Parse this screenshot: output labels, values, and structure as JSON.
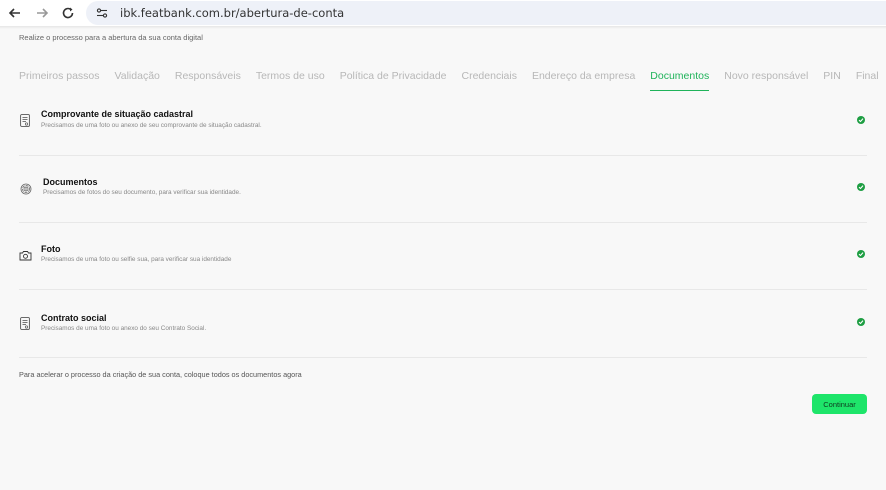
{
  "browser": {
    "url": "ibk.featbank.com.br/abertura-de-conta",
    "back_icon": "arrow-left-icon",
    "forward_icon": "arrow-right-icon",
    "reload_icon": "reload-icon"
  },
  "header": {
    "subtitle": "Realize o processo para a abertura da sua conta digital"
  },
  "tabs": [
    {
      "label": "Primeiros passos",
      "active": false
    },
    {
      "label": "Validação",
      "active": false
    },
    {
      "label": "Responsáveis",
      "active": false
    },
    {
      "label": "Termos de uso",
      "active": false
    },
    {
      "label": "Política de Privacidade",
      "active": false
    },
    {
      "label": "Credenciais",
      "active": false
    },
    {
      "label": "Endereço da empresa",
      "active": false
    },
    {
      "label": "Documentos",
      "active": true
    },
    {
      "label": "Novo responsável",
      "active": false
    },
    {
      "label": "PIN",
      "active": false
    },
    {
      "label": "Final",
      "active": false
    }
  ],
  "documents": [
    {
      "title": "Comprovante de situação cadastral",
      "description": "Precisamos de uma foto ou anexo de seu comprovante de situação cadastral.",
      "icon": "document-icon",
      "status": "check-icon"
    },
    {
      "title": "Documentos",
      "description": "Precisamos de fotos do seu documento, para verificar sua identidade.",
      "icon": "fingerprint-icon",
      "status": "check-icon"
    },
    {
      "title": "Foto",
      "description": "Precisamos de uma foto ou selfie sua, para verificar sua identidade",
      "icon": "camera-icon",
      "status": "check-icon"
    },
    {
      "title": "Contrato social",
      "description": "Precisamos de uma foto ou anexo do seu Contrato Social.",
      "icon": "document-icon",
      "status": "check-icon"
    }
  ],
  "footer": {
    "note": "Para acelerar o processo da criação de sua conta, coloque todos os documentos agora",
    "continue_label": "Continuar"
  },
  "colors": {
    "accent": "#1fb35a",
    "button": "#1ee56a",
    "check": "#1e9e43"
  }
}
